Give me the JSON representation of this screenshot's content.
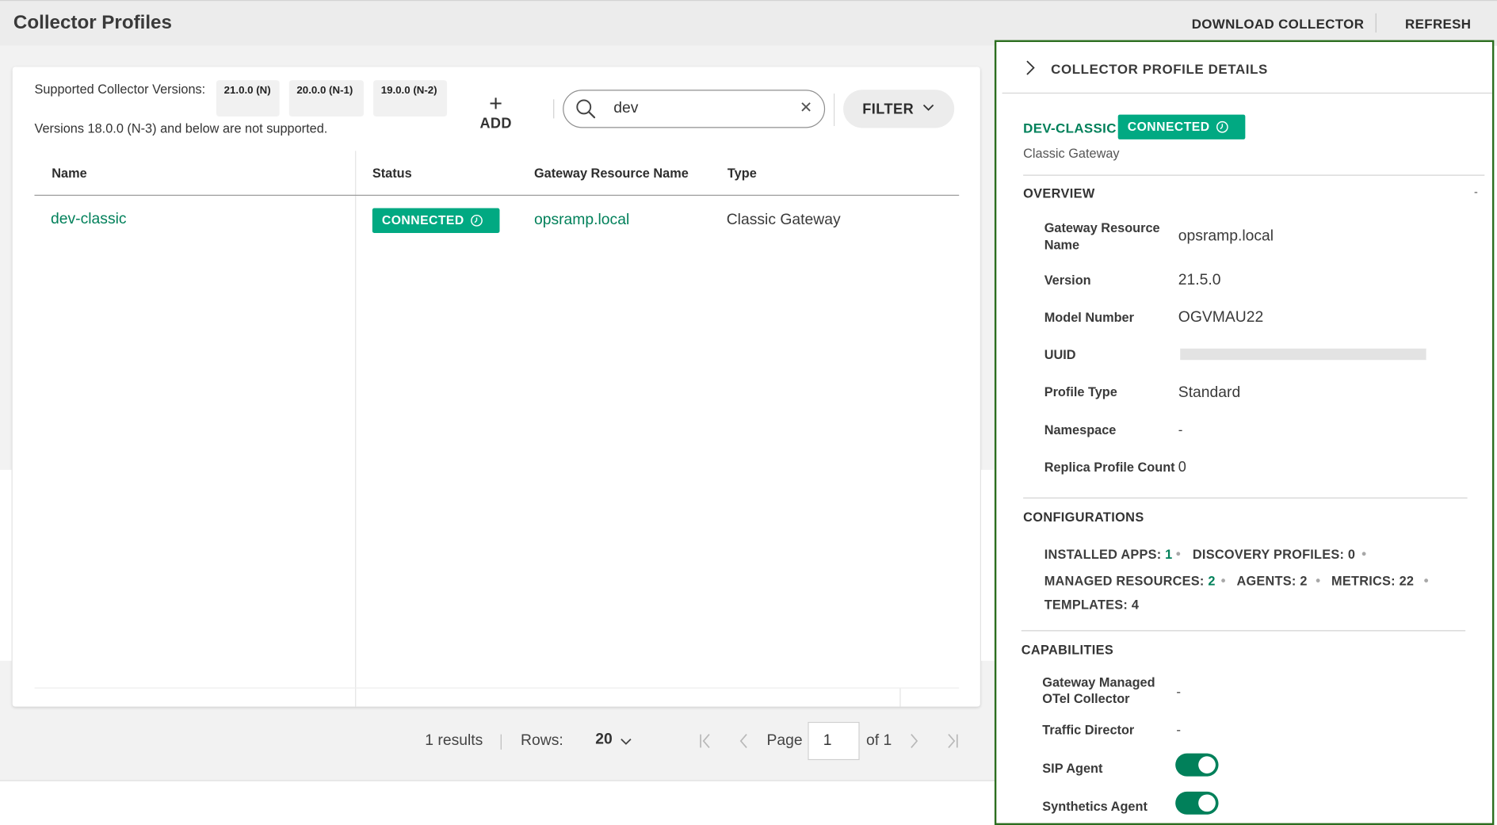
{
  "header": {
    "title": "Collector Profiles",
    "download_label": "DOWNLOAD COLLECTOR",
    "refresh_label": "REFRESH"
  },
  "versions": {
    "label": "Supported Collector Versions:",
    "chips": [
      "21.0.0 (N)",
      "20.0.0 (N-1)",
      "19.0.0 (N-2)"
    ],
    "note": "Versions 18.0.0 (N-3) and below are not supported."
  },
  "toolbar": {
    "add_label": "ADD",
    "search_value": "dev",
    "filter_label": "FILTER"
  },
  "table": {
    "columns": [
      "Name",
      "Status",
      "Gateway Resource Name",
      "Type"
    ],
    "rows": [
      {
        "name": "dev-classic",
        "status": "CONNECTED",
        "gateway": "opsramp.local",
        "type": "Classic Gateway"
      }
    ]
  },
  "pagination": {
    "results": "1 results",
    "rows_label": "Rows:",
    "rows_value": "20",
    "page_label": "Page",
    "page_value": "1",
    "of_label": "of 1"
  },
  "details": {
    "title": "COLLECTOR PROFILE DETAILS",
    "name": "DEV-CLASSIC",
    "status": "CONNECTED",
    "subtitle": "Classic Gateway",
    "overview_title": "OVERVIEW",
    "overview_collapse": "-",
    "overview": [
      {
        "label": "Gateway Resource Name",
        "value": "opsramp.local"
      },
      {
        "label": "Version",
        "value": "21.5.0"
      },
      {
        "label": "Model Number",
        "value": "OGVMAU22"
      },
      {
        "label": "UUID",
        "value": ""
      },
      {
        "label": "Profile Type",
        "value": "Standard"
      },
      {
        "label": "Namespace",
        "value": "-"
      },
      {
        "label": "Replica Profile Count",
        "value": "0"
      }
    ],
    "configurations_title": "CONFIGURATIONS",
    "configurations": [
      {
        "label": "INSTALLED APPS:",
        "value": "1"
      },
      {
        "label": "DISCOVERY PROFILES:",
        "value": "0"
      },
      {
        "label": "MANAGED RESOURCES:",
        "value": "2"
      },
      {
        "label": "AGENTS:",
        "value": "2"
      },
      {
        "label": "METRICS:",
        "value": "22"
      },
      {
        "label": "TEMPLATES:",
        "value": "4"
      }
    ],
    "capabilities_title": "CAPABILITIES",
    "capabilities": [
      {
        "label": "Gateway Managed OTel Collector",
        "value": "-"
      },
      {
        "label": "Traffic Director",
        "value": "-"
      },
      {
        "label": "SIP Agent",
        "value": "on"
      },
      {
        "label": "Synthetics Agent",
        "value": "on"
      }
    ]
  },
  "colors": {
    "accent_green": "#01805a",
    "status_green": "#01a982",
    "panel_border": "#2c6e1f"
  },
  "icons": [
    "search-icon",
    "clear-icon",
    "chevron-down-icon",
    "chevron-right-icon",
    "plus-icon",
    "clock-icon",
    "first-page-icon",
    "prev-page-icon",
    "next-page-icon",
    "last-page-icon"
  ]
}
